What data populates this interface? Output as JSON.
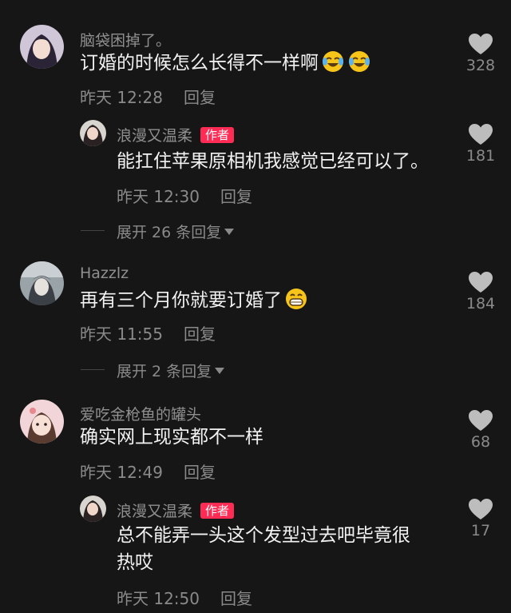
{
  "comments": [
    {
      "username": "脑袋困掉了。",
      "text": "订婚的时候怎么长得不一样啊",
      "emoji": [
        "laughing-crying-emoji",
        "laughing-crying-emoji"
      ],
      "time": "昨天 12:28",
      "reply_label": "回复",
      "likes": "328"
    },
    {
      "username": "浪漫又温柔",
      "author_badge": "作者",
      "text": "能扛住苹果原相机我感觉已经可以了。",
      "time": "昨天 12:30",
      "reply_label": "回复",
      "likes": "181"
    },
    {
      "expand_label": "展开 26 条回复"
    },
    {
      "username": "Hazzlz",
      "text": "再有三个月你就要订婚了",
      "emoji": [
        "grinning-emoji"
      ],
      "time": "昨天 11:55",
      "reply_label": "回复",
      "likes": "184"
    },
    {
      "expand_label": "展开 2 条回复"
    },
    {
      "username": "爱吃金枪鱼的罐头",
      "text": "确实网上现实都不一样",
      "time": "昨天 12:49",
      "reply_label": "回复",
      "likes": "68"
    },
    {
      "username": "浪漫又温柔",
      "author_badge": "作者",
      "text_line1": "总不能弄一头这个发型过去吧毕竟很",
      "text_line2": "热哎",
      "time": "昨天 12:50",
      "reply_label": "回复",
      "likes": "17"
    }
  ],
  "colors": {
    "background": "#161616",
    "author_badge": "#fe2c55",
    "muted_text": "#8a8a8a"
  }
}
